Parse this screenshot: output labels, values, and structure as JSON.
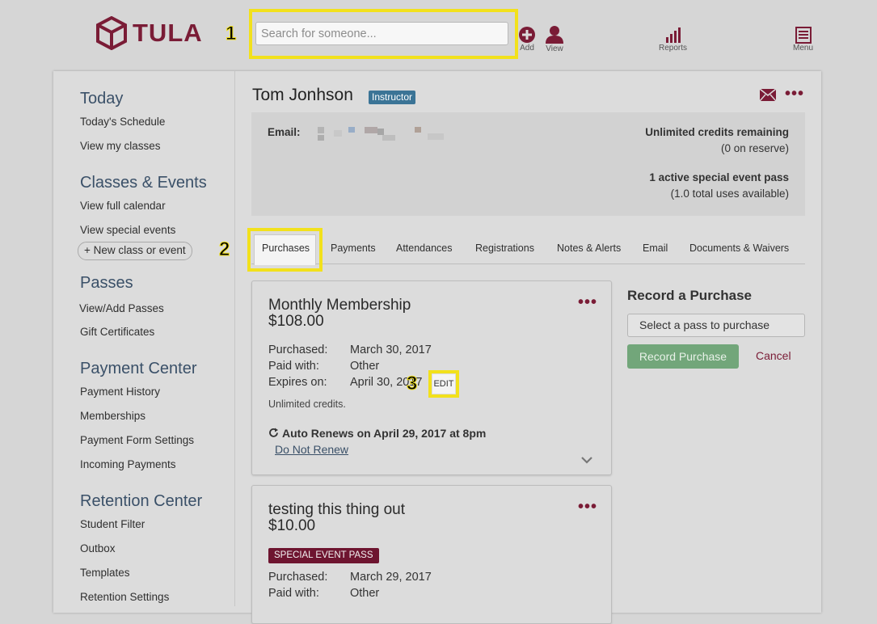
{
  "header": {
    "brand": "TULA",
    "search_placeholder": "Search for someone...",
    "add_label": "Add",
    "view_label": "View",
    "reports_label": "Reports",
    "menu_label": "Menu"
  },
  "callouts": [
    "1",
    "2",
    "3"
  ],
  "sidebar": {
    "sections": [
      {
        "title": "Today",
        "items": [
          "Today's Schedule",
          "View my classes"
        ]
      },
      {
        "title": "Classes & Events",
        "items": [
          "View full calendar",
          "View special events"
        ],
        "button": "+ New class or event"
      },
      {
        "title": "Passes",
        "items": [
          "View/Add Passes",
          "Gift Certificates"
        ]
      },
      {
        "title": "Payment Center",
        "items": [
          "Payment History",
          "Memberships",
          "Payment Form Settings",
          "Incoming Payments"
        ]
      },
      {
        "title": "Retention Center",
        "items": [
          "Student Filter",
          "Outbox",
          "Templates",
          "Retention Settings"
        ]
      }
    ]
  },
  "profile": {
    "name": "Tom Jonhson",
    "role_badge": "Instructor",
    "email_label": "Email:",
    "credits_line1": "Unlimited credits remaining",
    "credits_line2": "(0 on reserve)",
    "pass_line1": "1 active special event pass",
    "pass_line2": "(1.0 total uses available)"
  },
  "tabs": [
    "Purchases",
    "Payments",
    "Attendances",
    "Registrations",
    "Notes & Alerts",
    "Email",
    "Documents & Waivers"
  ],
  "active_tab": "Purchases",
  "purchases": [
    {
      "title": "Monthly Membership",
      "price": "$108.00",
      "purchased_label": "Purchased:",
      "purchased": "March 30, 2017",
      "paid_label": "Paid with:",
      "paid": "Other",
      "expires_label": "Expires on:",
      "expires": "April 30, 2017",
      "edit_label": "EDIT",
      "note": "Unlimited credits.",
      "renew": "Auto Renews on April 29, 2017 at 8pm",
      "renew_link": "Do Not Renew"
    },
    {
      "title": "testing this thing out",
      "price": "$10.00",
      "badge": "SPECIAL EVENT PASS",
      "purchased_label": "Purchased:",
      "purchased": "March 29, 2017",
      "paid_label": "Paid with:",
      "paid": "Other"
    }
  ],
  "record_purchase": {
    "title": "Record a Purchase",
    "select_value": "Select a pass to purchase",
    "submit_label": "Record Purchase",
    "cancel_label": "Cancel"
  },
  "colors": {
    "brand": "#7a1c36",
    "highlight": "#f2e11c",
    "badge_blue": "#3b7496",
    "green_button": "#72a67a"
  }
}
